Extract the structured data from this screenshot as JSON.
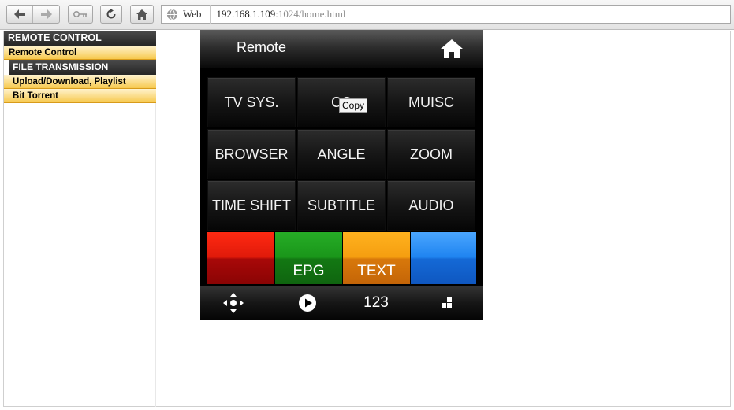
{
  "browser": {
    "address_scheme_label": "Web",
    "address_host": "192.168.1.109",
    "address_rest": ":1024/home.html",
    "icons": [
      "back-arrow-icon",
      "forward-arrow-icon",
      "key-icon",
      "reload-icon",
      "home-icon",
      "globe-icon"
    ]
  },
  "sidebar": {
    "header": "REMOTE CONTROL",
    "items": [
      {
        "label": "Remote Control"
      }
    ],
    "section2_header": "FILE TRANSMISSION",
    "section2_items": [
      {
        "label": "Upload/Download, Playlist"
      },
      {
        "label": "Bit Torrent"
      }
    ],
    "colors": {
      "header_bg": "#2e2e2e",
      "item_bg": "#f7c94e"
    }
  },
  "remote": {
    "title": "Remote",
    "buttons": [
      "TV SYS.",
      "CC",
      "MUISC",
      "BROWSER",
      "ANGLE",
      "ZOOM",
      "TIME SHIFT",
      "SUBTITLE",
      "AUDIO"
    ],
    "tooltip": "Copy",
    "color_buttons": [
      {
        "label": "",
        "color": "#e02010"
      },
      {
        "label": "EPG",
        "color": "#1f9a1f"
      },
      {
        "label": "TEXT",
        "color": "#f0a010"
      },
      {
        "label": "",
        "color": "#1f7fe8"
      }
    ],
    "bottom_bar": {
      "nav_icon": "dpad-arrows-icon",
      "play_icon": "play-circle-icon",
      "numeric_label": "123",
      "grid_icon": "grid-icon"
    }
  }
}
